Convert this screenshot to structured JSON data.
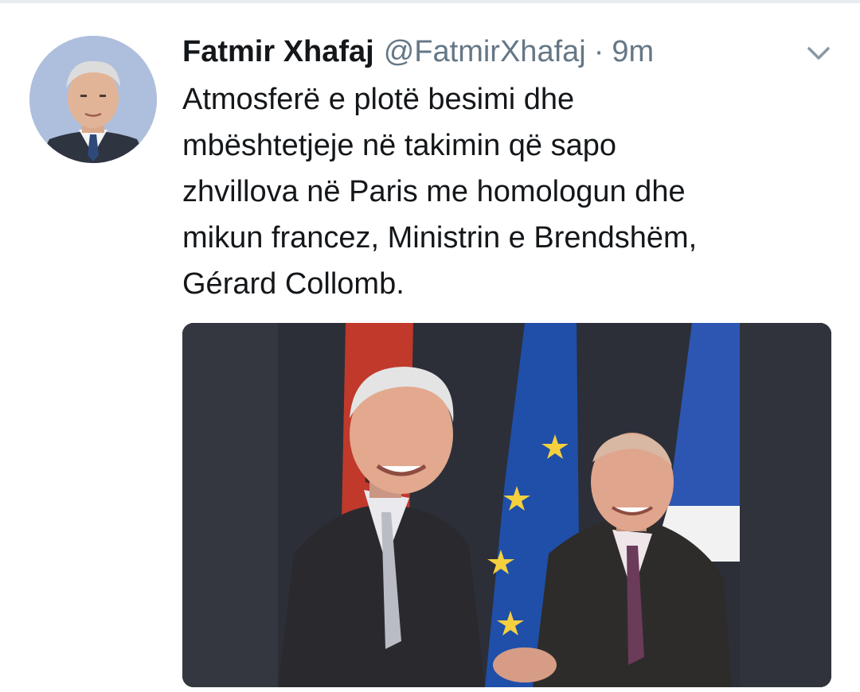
{
  "tweet": {
    "author": {
      "display_name": "Fatmir Xhafaj",
      "handle": "@FatmirXhafaj",
      "separator": "·",
      "time": "9m",
      "avatar_icon": "profile-photo"
    },
    "text_lines": [
      "Atmosferë e plotë besimi dhe",
      "mbështetjeje në takimin që sapo",
      "zhvillova në Paris me homologun dhe",
      "mikun francez, Ministrin e Brendshëm,",
      "Gérard Collomb."
    ],
    "menu_icon": "chevron-down-icon",
    "media": {
      "type": "photo",
      "description_icon": "photo-two-men-shaking-hands-flags"
    }
  },
  "colors": {
    "text_primary": "#14171a",
    "text_secondary": "#657786",
    "divider": "#e6ecf0",
    "avatar_bg": "#aebfdd"
  }
}
